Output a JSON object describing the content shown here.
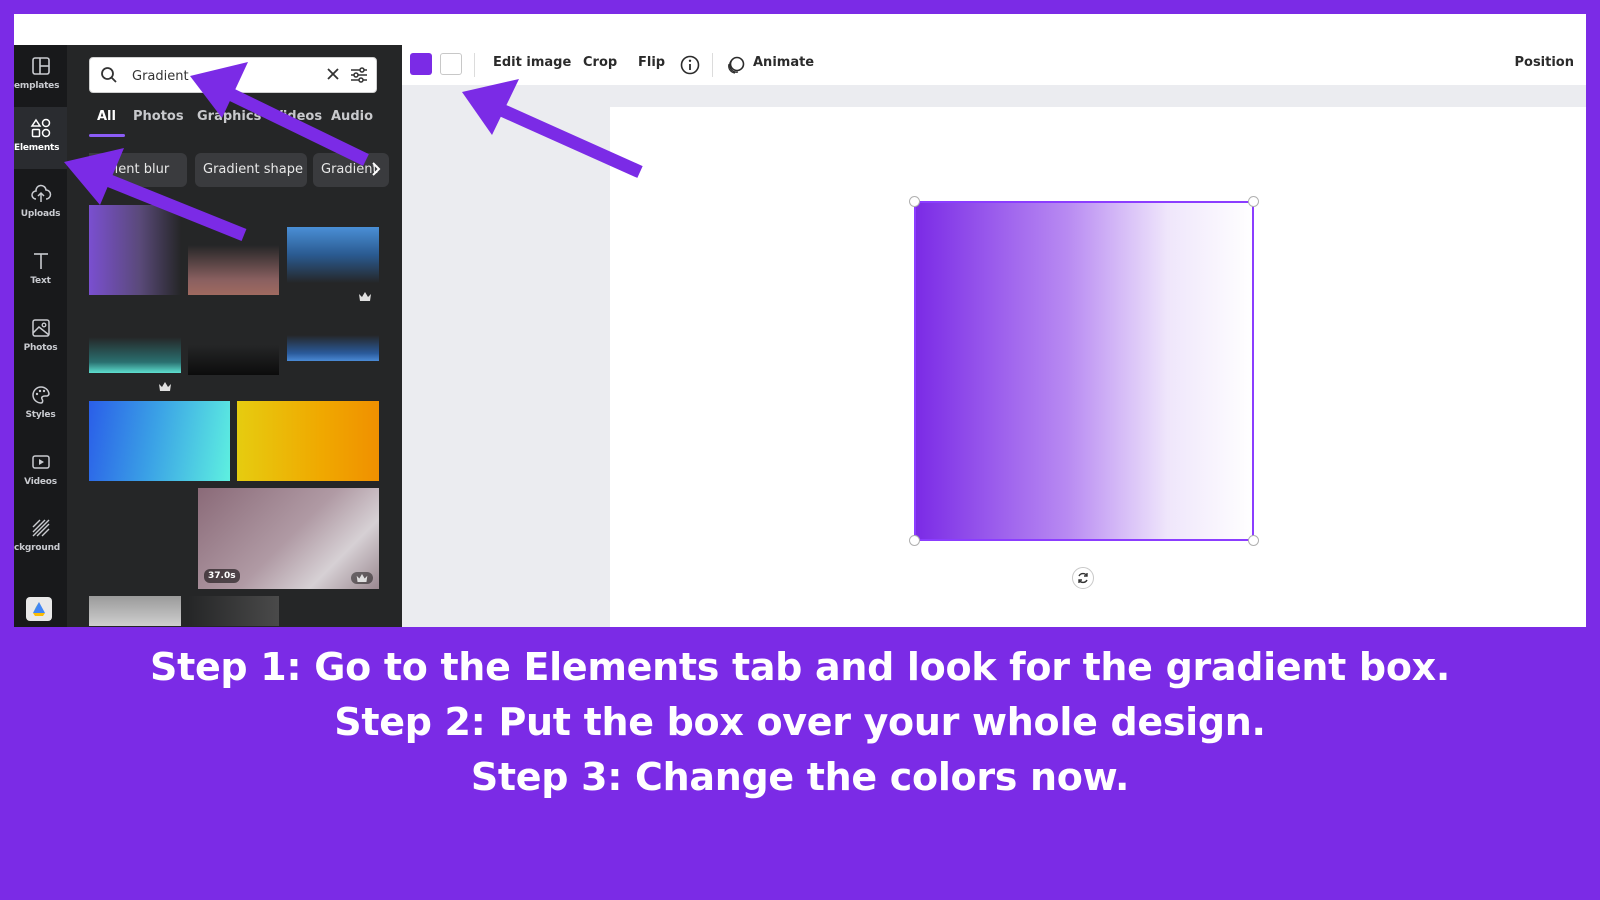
{
  "rail": {
    "items": [
      {
        "label": "emplates",
        "icon": "templates-icon"
      },
      {
        "label": "Elements",
        "icon": "elements-icon"
      },
      {
        "label": "Uploads",
        "icon": "uploads-icon"
      },
      {
        "label": "Text",
        "icon": "text-icon"
      },
      {
        "label": "Photos",
        "icon": "photos-icon"
      },
      {
        "label": "Styles",
        "icon": "styles-icon"
      },
      {
        "label": "Videos",
        "icon": "videos-icon"
      },
      {
        "label": "ckground",
        "icon": "background-icon"
      }
    ]
  },
  "search": {
    "value": "Gradient"
  },
  "tabs": [
    {
      "label": "All"
    },
    {
      "label": "Photos"
    },
    {
      "label": "Graphics"
    },
    {
      "label": "Videos"
    },
    {
      "label": "Audio"
    }
  ],
  "chips": [
    {
      "label": "Gradient blur"
    },
    {
      "label": "Gradient shape"
    },
    {
      "label": "Gradient"
    }
  ],
  "results": {
    "video_duration": "37.0s"
  },
  "toolbar": {
    "color_1": "#7b2be6",
    "color_2": "#ffffff",
    "edit_image": "Edit image",
    "crop": "Crop",
    "flip": "Flip",
    "animate": "Animate",
    "position": "Position"
  },
  "caption": {
    "step1": "Step 1: Go to the Elements tab and look for the gradient box.",
    "step2": "Step 2: Put the box over your whole design.",
    "step3": "Step 3: Change the colors now."
  },
  "colors": {
    "frame": "#7b2be6",
    "accent": "#8b3dff",
    "arrow": "#7b2be6"
  }
}
